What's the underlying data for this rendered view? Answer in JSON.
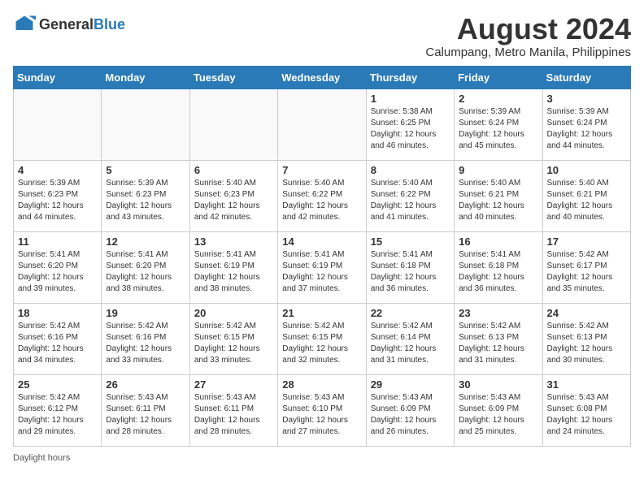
{
  "header": {
    "logo_general": "General",
    "logo_blue": "Blue",
    "month_year": "August 2024",
    "location": "Calumpang, Metro Manila, Philippines"
  },
  "days_of_week": [
    "Sunday",
    "Monday",
    "Tuesday",
    "Wednesday",
    "Thursday",
    "Friday",
    "Saturday"
  ],
  "weeks": [
    [
      {
        "day": "",
        "info": ""
      },
      {
        "day": "",
        "info": ""
      },
      {
        "day": "",
        "info": ""
      },
      {
        "day": "",
        "info": ""
      },
      {
        "day": "1",
        "info": "Sunrise: 5:38 AM\nSunset: 6:25 PM\nDaylight: 12 hours\nand 46 minutes."
      },
      {
        "day": "2",
        "info": "Sunrise: 5:39 AM\nSunset: 6:24 PM\nDaylight: 12 hours\nand 45 minutes."
      },
      {
        "day": "3",
        "info": "Sunrise: 5:39 AM\nSunset: 6:24 PM\nDaylight: 12 hours\nand 44 minutes."
      }
    ],
    [
      {
        "day": "4",
        "info": "Sunrise: 5:39 AM\nSunset: 6:23 PM\nDaylight: 12 hours\nand 44 minutes."
      },
      {
        "day": "5",
        "info": "Sunrise: 5:39 AM\nSunset: 6:23 PM\nDaylight: 12 hours\nand 43 minutes."
      },
      {
        "day": "6",
        "info": "Sunrise: 5:40 AM\nSunset: 6:23 PM\nDaylight: 12 hours\nand 42 minutes."
      },
      {
        "day": "7",
        "info": "Sunrise: 5:40 AM\nSunset: 6:22 PM\nDaylight: 12 hours\nand 42 minutes."
      },
      {
        "day": "8",
        "info": "Sunrise: 5:40 AM\nSunset: 6:22 PM\nDaylight: 12 hours\nand 41 minutes."
      },
      {
        "day": "9",
        "info": "Sunrise: 5:40 AM\nSunset: 6:21 PM\nDaylight: 12 hours\nand 40 minutes."
      },
      {
        "day": "10",
        "info": "Sunrise: 5:40 AM\nSunset: 6:21 PM\nDaylight: 12 hours\nand 40 minutes."
      }
    ],
    [
      {
        "day": "11",
        "info": "Sunrise: 5:41 AM\nSunset: 6:20 PM\nDaylight: 12 hours\nand 39 minutes."
      },
      {
        "day": "12",
        "info": "Sunrise: 5:41 AM\nSunset: 6:20 PM\nDaylight: 12 hours\nand 38 minutes."
      },
      {
        "day": "13",
        "info": "Sunrise: 5:41 AM\nSunset: 6:19 PM\nDaylight: 12 hours\nand 38 minutes."
      },
      {
        "day": "14",
        "info": "Sunrise: 5:41 AM\nSunset: 6:19 PM\nDaylight: 12 hours\nand 37 minutes."
      },
      {
        "day": "15",
        "info": "Sunrise: 5:41 AM\nSunset: 6:18 PM\nDaylight: 12 hours\nand 36 minutes."
      },
      {
        "day": "16",
        "info": "Sunrise: 5:41 AM\nSunset: 6:18 PM\nDaylight: 12 hours\nand 36 minutes."
      },
      {
        "day": "17",
        "info": "Sunrise: 5:42 AM\nSunset: 6:17 PM\nDaylight: 12 hours\nand 35 minutes."
      }
    ],
    [
      {
        "day": "18",
        "info": "Sunrise: 5:42 AM\nSunset: 6:16 PM\nDaylight: 12 hours\nand 34 minutes."
      },
      {
        "day": "19",
        "info": "Sunrise: 5:42 AM\nSunset: 6:16 PM\nDaylight: 12 hours\nand 33 minutes."
      },
      {
        "day": "20",
        "info": "Sunrise: 5:42 AM\nSunset: 6:15 PM\nDaylight: 12 hours\nand 33 minutes."
      },
      {
        "day": "21",
        "info": "Sunrise: 5:42 AM\nSunset: 6:15 PM\nDaylight: 12 hours\nand 32 minutes."
      },
      {
        "day": "22",
        "info": "Sunrise: 5:42 AM\nSunset: 6:14 PM\nDaylight: 12 hours\nand 31 minutes."
      },
      {
        "day": "23",
        "info": "Sunrise: 5:42 AM\nSunset: 6:13 PM\nDaylight: 12 hours\nand 31 minutes."
      },
      {
        "day": "24",
        "info": "Sunrise: 5:42 AM\nSunset: 6:13 PM\nDaylight: 12 hours\nand 30 minutes."
      }
    ],
    [
      {
        "day": "25",
        "info": "Sunrise: 5:42 AM\nSunset: 6:12 PM\nDaylight: 12 hours\nand 29 minutes."
      },
      {
        "day": "26",
        "info": "Sunrise: 5:43 AM\nSunset: 6:11 PM\nDaylight: 12 hours\nand 28 minutes."
      },
      {
        "day": "27",
        "info": "Sunrise: 5:43 AM\nSunset: 6:11 PM\nDaylight: 12 hours\nand 28 minutes."
      },
      {
        "day": "28",
        "info": "Sunrise: 5:43 AM\nSunset: 6:10 PM\nDaylight: 12 hours\nand 27 minutes."
      },
      {
        "day": "29",
        "info": "Sunrise: 5:43 AM\nSunset: 6:09 PM\nDaylight: 12 hours\nand 26 minutes."
      },
      {
        "day": "30",
        "info": "Sunrise: 5:43 AM\nSunset: 6:09 PM\nDaylight: 12 hours\nand 25 minutes."
      },
      {
        "day": "31",
        "info": "Sunrise: 5:43 AM\nSunset: 6:08 PM\nDaylight: 12 hours\nand 24 minutes."
      }
    ]
  ],
  "footer": {
    "daylight_hours": "Daylight hours"
  }
}
